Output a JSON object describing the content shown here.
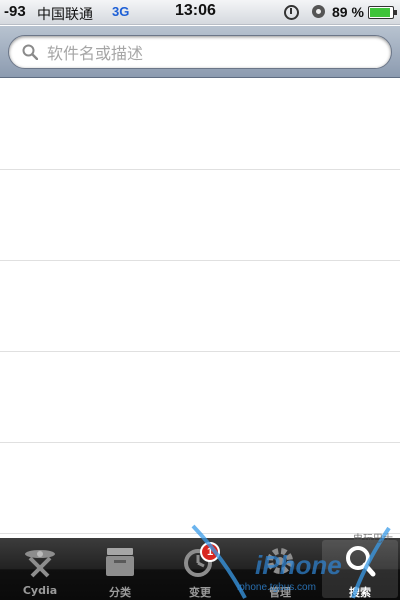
{
  "status_bar": {
    "signal": "-93",
    "carrier": "中国联通",
    "network": "3G",
    "time": "13:06",
    "battery_percent": "89 %",
    "battery_level": 0.89,
    "icons": [
      "clock-icon",
      "orientation-lock-icon",
      "battery-icon"
    ]
  },
  "search": {
    "placeholder": "软件名或描述",
    "value": "",
    "icon": "search-icon"
  },
  "results": {
    "row_count": 5
  },
  "tabbar": {
    "active_tab": "搜索",
    "tabs": [
      {
        "label": "Cydia",
        "icon": "cydia-icon"
      },
      {
        "label": "分类",
        "icon": "sections-icon"
      },
      {
        "label": "变更",
        "icon": "changes-icon",
        "badge": "1"
      },
      {
        "label": "管理",
        "icon": "manage-icon"
      },
      {
        "label": "搜索",
        "icon": "search-icon"
      }
    ]
  },
  "watermark": {
    "brand": "iPhone",
    "url": "iphone.tgbus.com",
    "tag": "电玩巴士",
    "colors": [
      "#3a9be8",
      "#2f86d6"
    ]
  }
}
